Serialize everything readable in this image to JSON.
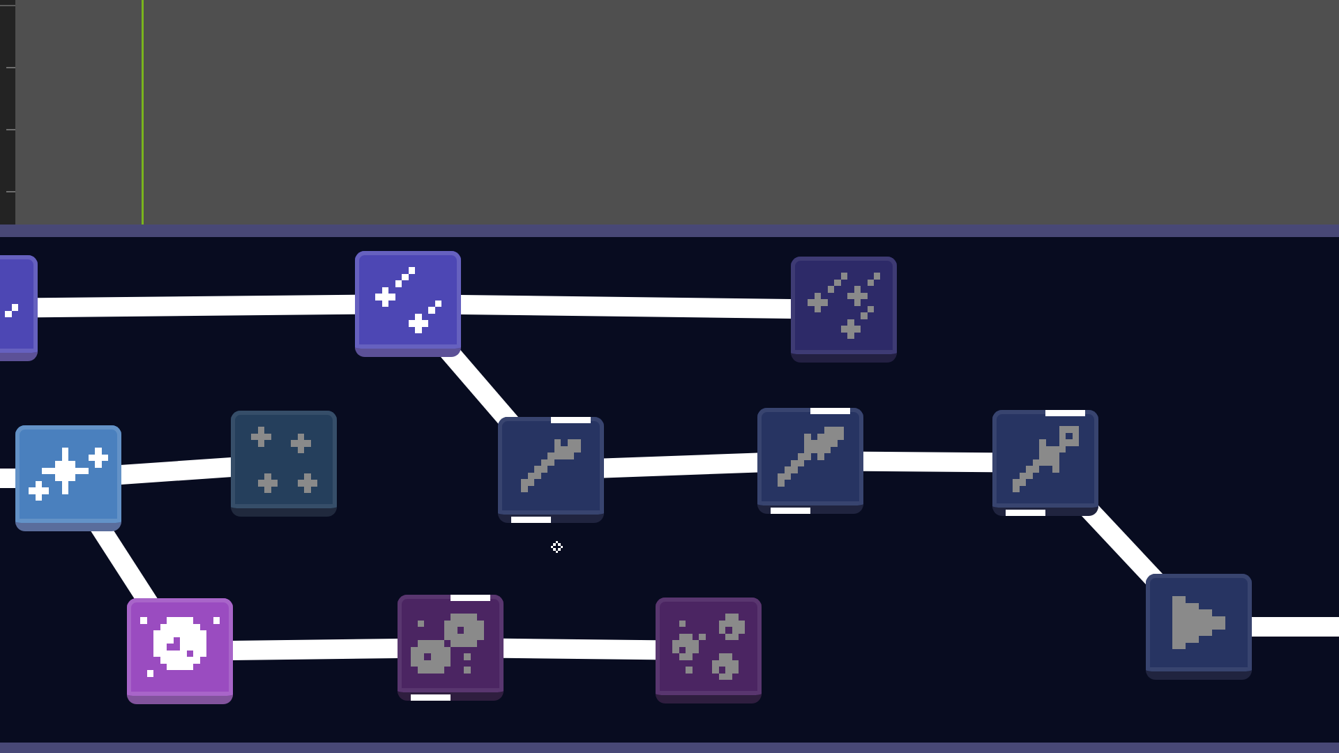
{
  "timeline": {
    "marker": true
  },
  "level_map": {
    "cursor": true,
    "nodes": [
      {
        "kind": "comet",
        "color": "#4d47b4",
        "locked": false,
        "highlighted": false,
        "children": [
          {
            "kind": "comet",
            "color": "#4d47b4",
            "locked": false,
            "highlighted": false,
            "children": [
              {
                "kind": "comets",
                "color": "#2d2a68",
                "locked": true,
                "highlighted": false
              },
              {
                "kind": "dagger",
                "color": "#273462",
                "locked": true,
                "highlighted": true,
                "children": [
                  {
                    "kind": "sword",
                    "color": "#273462",
                    "locked": true,
                    "highlighted": true,
                    "children": [
                      {
                        "kind": "rapier",
                        "color": "#273462",
                        "locked": true,
                        "highlighted": true,
                        "children": [
                          {
                            "kind": "play",
                            "color": "#273462",
                            "locked": true,
                            "highlighted": false,
                            "continues_right": true
                          }
                        ]
                      }
                    ]
                  }
                ]
              }
            ]
          }
        ]
      },
      {
        "kind": "sparkles",
        "color": "#4a80be",
        "locked": false,
        "highlighted": false,
        "continues_left": true,
        "children": [
          {
            "kind": "stars",
            "color": "#253f5c",
            "locked": true,
            "highlighted": false
          },
          {
            "kind": "moon",
            "color": "#9a4cc0",
            "locked": false,
            "highlighted": false,
            "children": [
              {
                "kind": "boulders",
                "color": "#4b2562",
                "locked": true,
                "highlighted": true,
                "children": [
                  {
                    "kind": "pebbles",
                    "color": "#4b2562",
                    "locked": true,
                    "highlighted": false
                  }
                ]
              }
            ]
          }
        ]
      }
    ]
  }
}
